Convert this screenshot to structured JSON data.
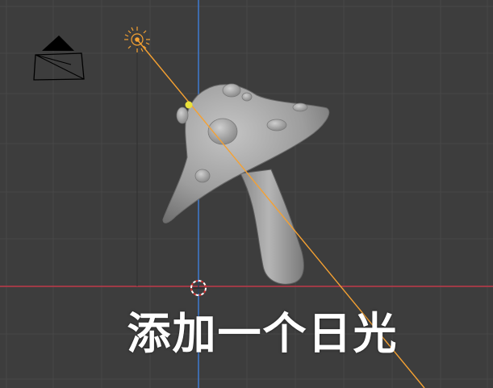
{
  "viewport": {
    "background": "#3d3d3d",
    "grid_color": "#484848",
    "x_axis_color": "#c0394a",
    "y_axis_color": "#3f7bd2"
  },
  "objects": {
    "mushroom": {
      "icon": "mushroom-mesh",
      "color": "#9a9a9a"
    },
    "sun_lamp": {
      "icon": "sun-lamp-icon",
      "color": "#f5a132"
    },
    "light_direction": {
      "color": "#f5a132"
    },
    "camera": {
      "icon": "camera-icon"
    },
    "cursor_3d": {
      "icon": "3d-cursor-icon"
    },
    "selected_vertex": {
      "color": "#e8e03a"
    }
  },
  "caption": {
    "text": "添加一个日光"
  }
}
